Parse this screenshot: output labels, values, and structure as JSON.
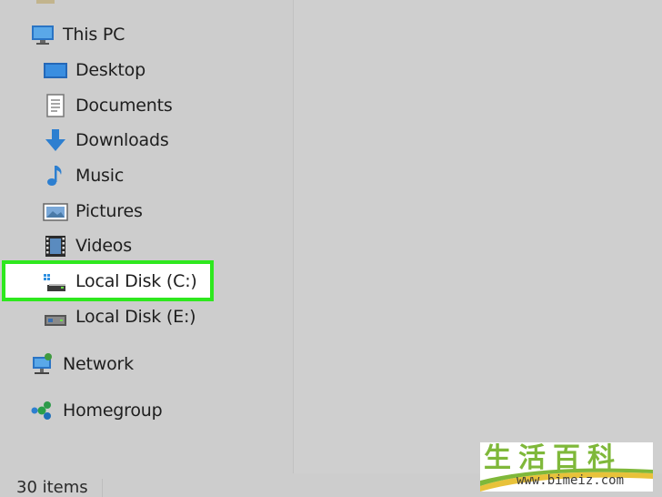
{
  "nav": {
    "items": [
      {
        "label": "This PC",
        "icon": "this-pc-icon"
      },
      {
        "label": "Desktop",
        "icon": "desktop-icon"
      },
      {
        "label": "Documents",
        "icon": "documents-icon"
      },
      {
        "label": "Downloads",
        "icon": "downloads-icon"
      },
      {
        "label": "Music",
        "icon": "music-icon"
      },
      {
        "label": "Pictures",
        "icon": "pictures-icon"
      },
      {
        "label": "Videos",
        "icon": "videos-icon"
      },
      {
        "label": "Local Disk (C:)",
        "icon": "local-disk-c-icon",
        "highlighted": true
      },
      {
        "label": "Local Disk (E:)",
        "icon": "local-disk-e-icon"
      },
      {
        "label": "Network",
        "icon": "network-icon"
      },
      {
        "label": "Homegroup",
        "icon": "homegroup-icon"
      }
    ]
  },
  "status": {
    "item_count": "30 items"
  },
  "watermark": {
    "chars": "生活百科",
    "url": "www.bimeiz.com"
  },
  "colors": {
    "highlight_border": "#2ee81e",
    "background": "#cdcdcd",
    "icon_blue": "#2d7fd0"
  }
}
